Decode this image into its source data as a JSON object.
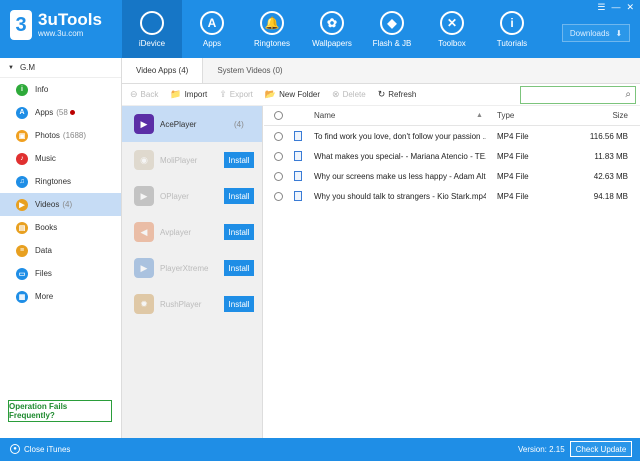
{
  "app": {
    "name": "3uTools",
    "url": "www.3u.com",
    "logo_glyph": "3"
  },
  "nav": [
    {
      "label": "iDevice",
      "icon": "apple-icon",
      "glyph": "",
      "active": true
    },
    {
      "label": "Apps",
      "icon": "appstore-icon",
      "glyph": "A",
      "active": false
    },
    {
      "label": "Ringtones",
      "icon": "bell-icon",
      "glyph": "🔔",
      "active": false
    },
    {
      "label": "Wallpapers",
      "icon": "flower-icon",
      "glyph": "✿",
      "active": false
    },
    {
      "label": "Flash & JB",
      "icon": "dropbox-icon",
      "glyph": "◆",
      "active": false
    },
    {
      "label": "Toolbox",
      "icon": "tools-icon",
      "glyph": "✕",
      "active": false
    },
    {
      "label": "Tutorials",
      "icon": "info-icon",
      "glyph": "i",
      "active": false
    }
  ],
  "window_controls": {
    "menu": "☰",
    "minimize": "—",
    "close": "✕"
  },
  "downloads": {
    "label": "Downloads",
    "arrow": "⬇"
  },
  "device_name": "G.M",
  "sidebar": [
    {
      "label": "Info",
      "count": "",
      "icon": "info-icon",
      "color": "#2eaa3a",
      "glyph": "i",
      "active": false,
      "dot": false
    },
    {
      "label": "Apps",
      "count": "(58",
      "icon": "apps-icon",
      "color": "#1f8ee6",
      "glyph": "A",
      "active": false,
      "dot": true
    },
    {
      "label": "Photos",
      "count": "(1688)",
      "icon": "photos-icon",
      "color": "#f0a020",
      "glyph": "▣",
      "active": false,
      "dot": false
    },
    {
      "label": "Music",
      "count": "",
      "icon": "music-icon",
      "color": "#e03030",
      "glyph": "♪",
      "active": false,
      "dot": false
    },
    {
      "label": "Ringtones",
      "count": "",
      "icon": "bell-icon",
      "color": "#1f8ee6",
      "glyph": "♫",
      "active": false,
      "dot": false
    },
    {
      "label": "Videos",
      "count": "(4)",
      "icon": "video-icon",
      "color": "#e8a020",
      "glyph": "▶",
      "active": true,
      "dot": false
    },
    {
      "label": "Books",
      "count": "",
      "icon": "book-icon",
      "color": "#e8a020",
      "glyph": "▤",
      "active": false,
      "dot": false
    },
    {
      "label": "Data",
      "count": "",
      "icon": "data-icon",
      "color": "#e8a020",
      "glyph": "≡",
      "active": false,
      "dot": false
    },
    {
      "label": "Files",
      "count": "",
      "icon": "files-icon",
      "color": "#1f8ee6",
      "glyph": "▭",
      "active": false,
      "dot": false
    },
    {
      "label": "More",
      "count": "",
      "icon": "more-icon",
      "color": "#1f8ee6",
      "glyph": "▦",
      "active": false,
      "dot": false
    }
  ],
  "op_fails": "Operation Fails Frequently?",
  "tabs": [
    {
      "label": "Video Apps (4)",
      "active": true
    },
    {
      "label": "System Videos (0)",
      "active": false
    }
  ],
  "toolbar": [
    {
      "label": "Back",
      "icon": "back-icon",
      "glyph": "⊖",
      "disabled": true
    },
    {
      "label": "Import",
      "icon": "import-icon",
      "glyph": "📁",
      "disabled": false
    },
    {
      "label": "Export",
      "icon": "export-icon",
      "glyph": "⇪",
      "disabled": true
    },
    {
      "label": "New Folder",
      "icon": "new-folder-icon",
      "glyph": "📂",
      "disabled": false
    },
    {
      "label": "Delete",
      "icon": "delete-icon",
      "glyph": "⊗",
      "disabled": true
    },
    {
      "label": "Refresh",
      "icon": "refresh-icon",
      "glyph": "↻",
      "disabled": false
    }
  ],
  "search": {
    "value": "",
    "placeholder": ""
  },
  "apps": [
    {
      "name": "AcePlayer",
      "count": "(4)",
      "installed": true,
      "color": "#5b2ea6",
      "glyph": "▶",
      "icon": "aceplayer-icon"
    },
    {
      "name": "MoliPlayer",
      "count": "",
      "installed": false,
      "install_label": "Install",
      "color": "#c0b090",
      "glyph": "◉",
      "icon": "moliplayer-icon"
    },
    {
      "name": "OPlayer",
      "count": "",
      "installed": false,
      "install_label": "Install",
      "color": "#707070",
      "glyph": "▶",
      "icon": "oplayer-icon"
    },
    {
      "name": "Avplayer",
      "count": "",
      "installed": false,
      "install_label": "Install",
      "color": "#e06020",
      "glyph": "◀",
      "icon": "avplayer-icon"
    },
    {
      "name": "PlayerXtreme",
      "count": "",
      "installed": false,
      "install_label": "Install",
      "color": "#2a6fc0",
      "glyph": "▶",
      "icon": "playerxtreme-icon"
    },
    {
      "name": "RushPlayer",
      "count": "",
      "installed": false,
      "install_label": "Install",
      "color": "#c08020",
      "glyph": "✹",
      "icon": "rushplayer-icon"
    }
  ],
  "file_headers": {
    "name": "Name",
    "type": "Type",
    "size": "Size"
  },
  "files": [
    {
      "name": "To find work you love, don't follow your passion ...",
      "type": "MP4 File",
      "size": "116.56 MB"
    },
    {
      "name": "What makes you special- - Mariana Atencio - TE...",
      "type": "MP4 File",
      "size": "11.83 MB"
    },
    {
      "name": "Why our screens make us less happy - Adam Alte...",
      "type": "MP4 File",
      "size": "42.63 MB"
    },
    {
      "name": "Why you should talk to strangers - Kio Stark.mp4",
      "type": "MP4 File",
      "size": "94.18 MB"
    }
  ],
  "bottom": {
    "close_itunes": "Close iTunes",
    "version": "Version: 2.15",
    "check_update": "Check Update"
  },
  "colors": {
    "brand": "#1f8ee6",
    "active_row": "#c6dcf5",
    "op_fails": "#2a9d3a"
  }
}
